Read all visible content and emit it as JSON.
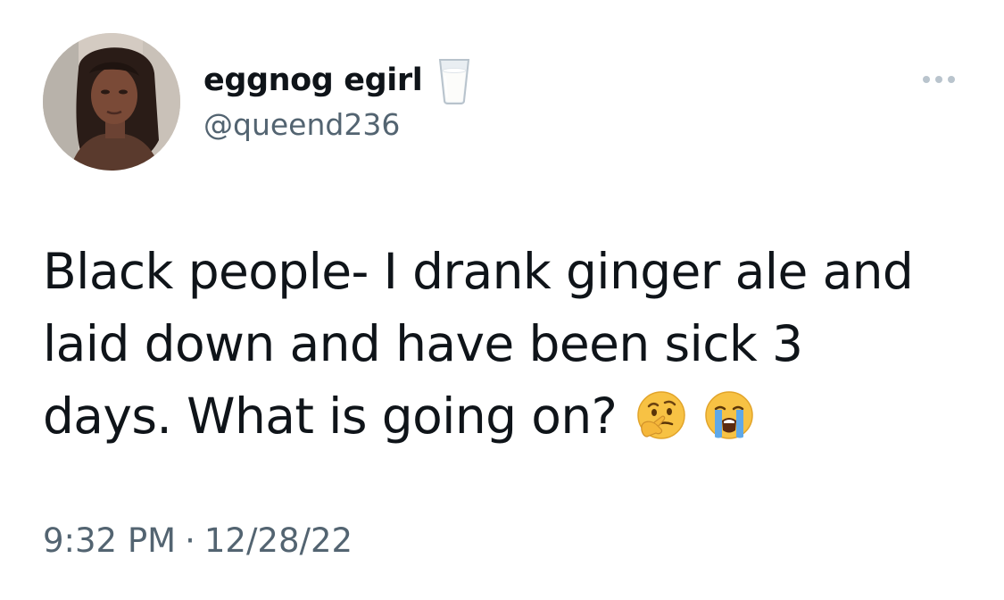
{
  "tweet": {
    "author": {
      "display_name": "eggnog egirl",
      "name_emoji": "glass-of-milk-icon",
      "handle": "@queend236",
      "avatar": "profile-photo"
    },
    "more_menu": "more-options-icon",
    "text_lines": [
      "Black people- I drank ginger ale and",
      "laid down and have been sick 3",
      "days. What is going on?"
    ],
    "text_emojis": [
      "thinking-face-icon",
      "loudly-crying-face-icon"
    ],
    "time": "9:32 PM",
    "separator": "·",
    "date": "12/28/22"
  },
  "colors": {
    "text_primary": "#0f1419",
    "text_secondary": "#536471",
    "background": "#ffffff"
  }
}
